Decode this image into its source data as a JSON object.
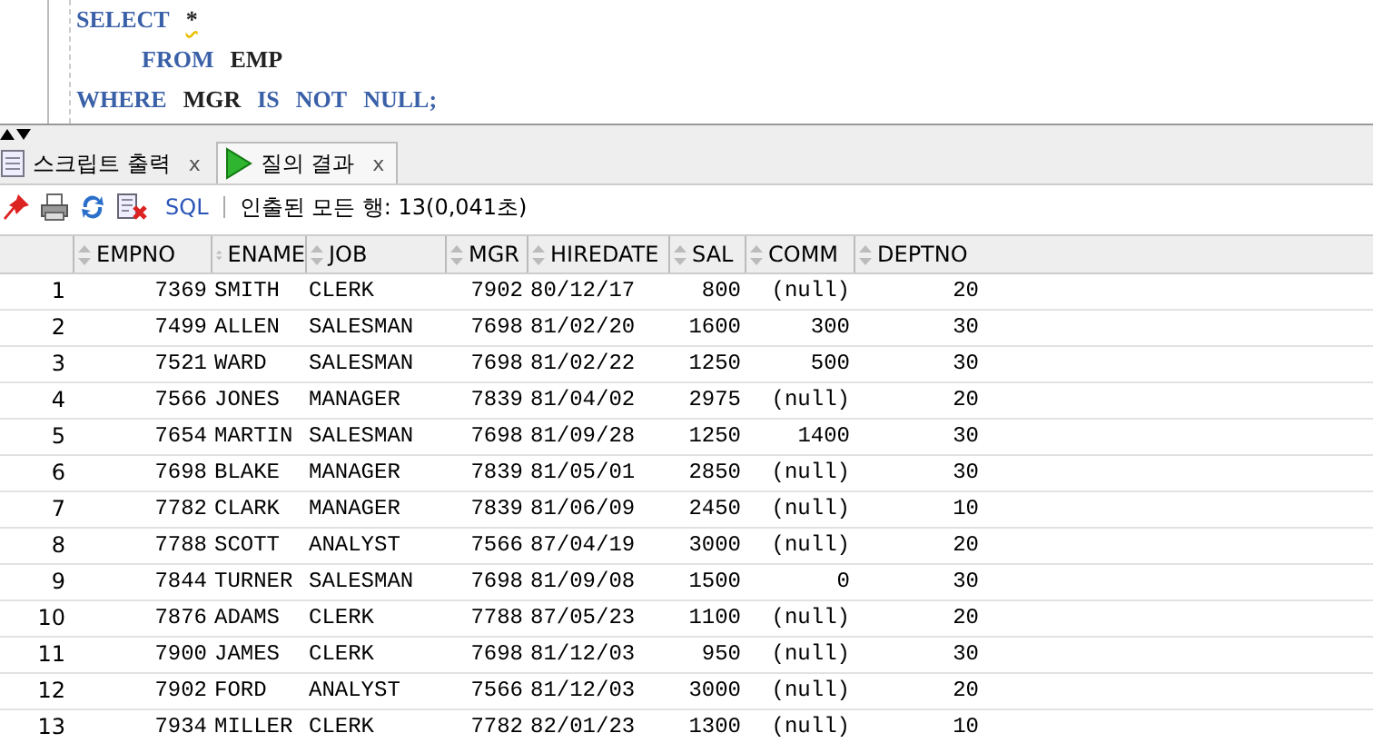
{
  "editor": {
    "lines": [
      {
        "tokens": [
          {
            "kind": "keyword",
            "text": "SELECT"
          },
          {
            "kind": "warn",
            "text": "*"
          }
        ],
        "children": [
          {
            "tokens": [
              {
                "kind": "keyword",
                "text": "FROM"
              },
              {
                "kind": "ident",
                "text": "EMP"
              }
            ]
          }
        ]
      },
      {
        "tokens": [
          {
            "kind": "keyword",
            "text": "WHERE"
          },
          {
            "kind": "ident",
            "text": "MGR"
          },
          {
            "kind": "keyword",
            "text": "IS"
          },
          {
            "kind": "keyword",
            "text": "NOT"
          },
          {
            "kind": "keyword",
            "text": "NULL;"
          }
        ]
      }
    ]
  },
  "tabs": [
    {
      "label": "스크립트 출력",
      "close": "x",
      "selected": false
    },
    {
      "label": "질의 결과",
      "close": "x",
      "selected": true
    }
  ],
  "toolbar": {
    "sql": "SQL",
    "status": "인출된 모든 행: 13(0,041초)"
  },
  "table": {
    "columns": [
      {
        "label": "EMPNO",
        "kind": "number"
      },
      {
        "label": "ENAME",
        "kind": "text"
      },
      {
        "label": "JOB",
        "kind": "text"
      },
      {
        "label": "MGR",
        "kind": "number"
      },
      {
        "label": "HIREDATE",
        "kind": "text"
      },
      {
        "label": "SAL",
        "kind": "number"
      },
      {
        "label": "COMM",
        "kind": "number"
      },
      {
        "label": "DEPTNO",
        "kind": "number"
      }
    ],
    "rows": [
      {
        "num": "1",
        "cells": [
          "7369",
          "SMITH",
          "CLERK",
          "7902",
          "80/12/17",
          "800",
          "(null)",
          "20"
        ]
      },
      {
        "num": "2",
        "cells": [
          "7499",
          "ALLEN",
          "SALESMAN",
          "7698",
          "81/02/20",
          "1600",
          "300",
          "30"
        ]
      },
      {
        "num": "3",
        "cells": [
          "7521",
          "WARD",
          "SALESMAN",
          "7698",
          "81/02/22",
          "1250",
          "500",
          "30"
        ]
      },
      {
        "num": "4",
        "cells": [
          "7566",
          "JONES",
          "MANAGER",
          "7839",
          "81/04/02",
          "2975",
          "(null)",
          "20"
        ]
      },
      {
        "num": "5",
        "cells": [
          "7654",
          "MARTIN",
          "SALESMAN",
          "7698",
          "81/09/28",
          "1250",
          "1400",
          "30"
        ]
      },
      {
        "num": "6",
        "cells": [
          "7698",
          "BLAKE",
          "MANAGER",
          "7839",
          "81/05/01",
          "2850",
          "(null)",
          "30"
        ]
      },
      {
        "num": "7",
        "cells": [
          "7782",
          "CLARK",
          "MANAGER",
          "7839",
          "81/06/09",
          "2450",
          "(null)",
          "10"
        ]
      },
      {
        "num": "8",
        "cells": [
          "7788",
          "SCOTT",
          "ANALYST",
          "7566",
          "87/04/19",
          "3000",
          "(null)",
          "20"
        ]
      },
      {
        "num": "9",
        "cells": [
          "7844",
          "TURNER",
          "SALESMAN",
          "7698",
          "81/09/08",
          "1500",
          "0",
          "30"
        ]
      },
      {
        "num": "10",
        "cells": [
          "7876",
          "ADAMS",
          "CLERK",
          "7788",
          "87/05/23",
          "1100",
          "(null)",
          "20"
        ]
      },
      {
        "num": "11",
        "cells": [
          "7900",
          "JAMES",
          "CLERK",
          "7698",
          "81/12/03",
          "950",
          "(null)",
          "30"
        ]
      },
      {
        "num": "12",
        "cells": [
          "7902",
          "FORD",
          "ANALYST",
          "7566",
          "81/12/03",
          "3000",
          "(null)",
          "20"
        ]
      },
      {
        "num": "13",
        "cells": [
          "7934",
          "MILLER",
          "CLERK",
          "7782",
          "82/01/23",
          "1300",
          "(null)",
          "10"
        ]
      }
    ]
  }
}
